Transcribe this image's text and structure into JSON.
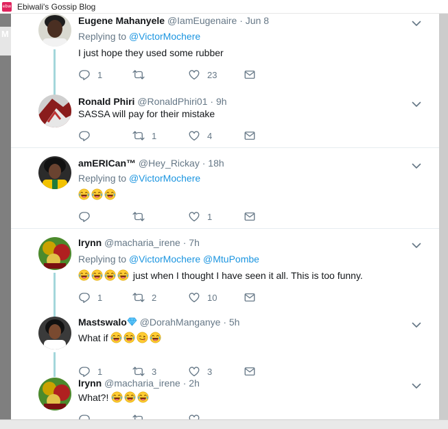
{
  "window": {
    "title": "Ebiwali's Gossip Blog",
    "left_tab_letter": "M"
  },
  "colors": {
    "accent": "#1b95e0",
    "thread_line": "#a3d6db",
    "muted": "#657786"
  },
  "tweets": [
    {
      "name": "Eugene Mahanyele",
      "handle": "@IamEugenaire",
      "time": "Jun 8",
      "replying_prefix": "Replying to",
      "mentions": [
        "@VictorMochere"
      ],
      "text": "I just hope they used some rubber",
      "reply_count": "1",
      "retweet_count": "",
      "like_count": "23"
    },
    {
      "name": "Ronald Phiri",
      "handle": "@RonaldPhiri01",
      "time": "9h",
      "text": "SASSA will pay for their mistake",
      "reply_count": "",
      "retweet_count": "1",
      "like_count": "4"
    },
    {
      "name": "amERICan™",
      "handle": "@Hey_Rickay",
      "time": "18h",
      "replying_prefix": "Replying to",
      "mentions": [
        "@VictorMochere"
      ],
      "emoji_count": 3,
      "reply_count": "",
      "retweet_count": "",
      "like_count": "1"
    },
    {
      "name": "Irynn",
      "handle": "@macharia_irene",
      "time": "7h",
      "replying_prefix": "Replying to",
      "mentions": [
        "@VictorMochere",
        "@MtuPombe"
      ],
      "text": "just when I thought I have seen it all. This is too funny.",
      "reply_count": "1",
      "retweet_count": "2",
      "like_count": "10"
    },
    {
      "name": "Mastswalo",
      "handle": "@DorahManganye",
      "time": "5h",
      "text": "What if",
      "reply_count": "1",
      "retweet_count": "3",
      "like_count": "3"
    },
    {
      "name": "Irynn",
      "handle": "@macharia_irene",
      "time": "2h",
      "text": "What?!",
      "reply_count": "",
      "retweet_count": "",
      "like_count": ""
    }
  ]
}
